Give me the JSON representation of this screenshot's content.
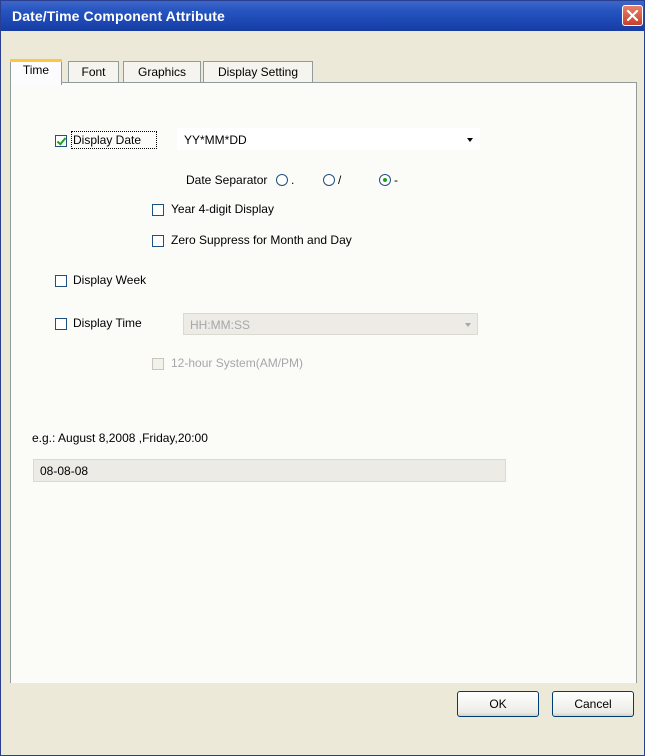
{
  "window": {
    "title": "Date/Time Component Attribute"
  },
  "tabs": [
    {
      "label": "Time",
      "active": true
    },
    {
      "label": "Font",
      "active": false
    },
    {
      "label": "Graphics",
      "active": false
    },
    {
      "label": "Display Setting",
      "active": false
    }
  ],
  "time": {
    "display_date": {
      "label": "Display Date",
      "checked": true
    },
    "date_format": {
      "value": "YY*MM*DD"
    },
    "date_separator": {
      "label": "Date Separator",
      "options": [
        {
          "label": ".",
          "selected": false
        },
        {
          "label": "/",
          "selected": false
        },
        {
          "label": "-",
          "selected": true
        }
      ]
    },
    "year_4digit": {
      "label": "Year 4-digit Display",
      "checked": false
    },
    "zero_suppress": {
      "label": "Zero Suppress for Month and Day",
      "checked": false
    },
    "display_week": {
      "label": "Display Week",
      "checked": false
    },
    "display_time": {
      "label": "Display Time",
      "checked": false
    },
    "time_format": {
      "value": "HH:MM:SS"
    },
    "twelve_hour": {
      "label": "12-hour System(AM/PM)",
      "checked": false
    },
    "example_label": "e.g.: August 8,2008 ,Friday,20:00",
    "example_value": "08-08-08"
  },
  "buttons": {
    "ok": "OK",
    "cancel": "Cancel"
  },
  "colors": {
    "title_bar": "#1c47b4",
    "close_button": "#c8402a",
    "active_tab_accent": "#ffc83c",
    "check_mark": "#21a121"
  }
}
